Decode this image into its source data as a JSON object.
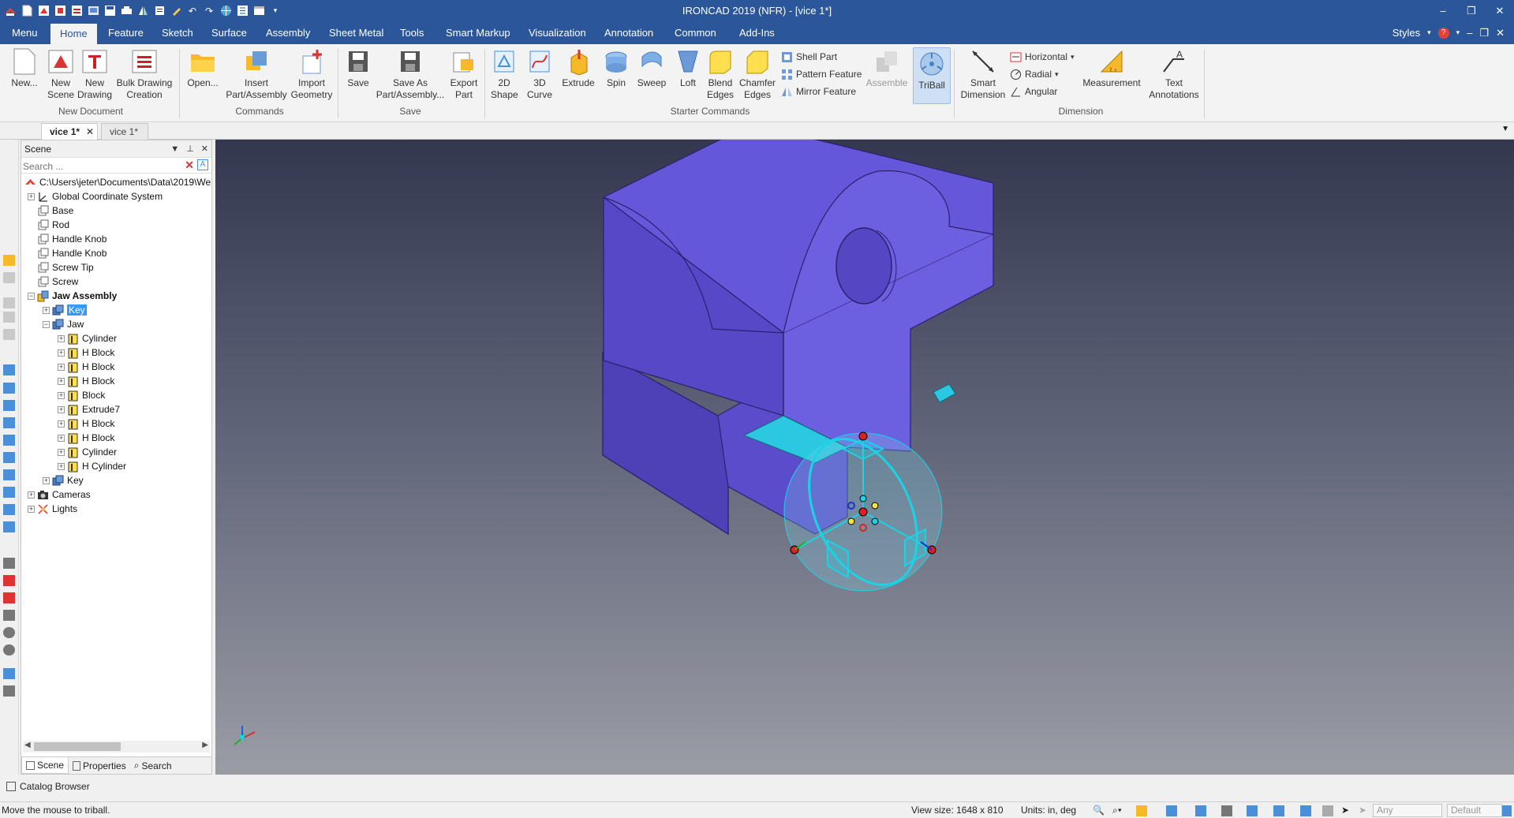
{
  "app": {
    "title": "IRONCAD 2019 (NFR) - [vice 1*]"
  },
  "qat": {
    "icons": [
      "new-file-icon",
      "new-scene-icon",
      "new-drawing-icon",
      "save-icon",
      "print-icon",
      "undo-icon",
      "redo-icon",
      "web-icon",
      "settings-icon",
      "dropdown-icon"
    ]
  },
  "menubar": {
    "tabs": [
      "Menu",
      "Home",
      "Feature",
      "Sketch",
      "Surface",
      "Assembly",
      "Sheet Metal",
      "Tools",
      "Smart Markup",
      "Visualization",
      "Annotation",
      "Common",
      "Add-Ins"
    ],
    "active": "Home",
    "styles_label": "Styles",
    "accent": "#2b579a"
  },
  "ribbon": {
    "new_label": "New...",
    "new_scene_label": "New Scene",
    "new_drawing_label": "New Drawing",
    "bulk_drawing_label": "Bulk Drawing Creation",
    "group_new_document": "New Document",
    "open_label": "Open...",
    "insert_label": "Insert Part/Assembly",
    "import_label": "Import Geometry",
    "group_commands": "Commands",
    "save_label": "Save",
    "save_as_label": "Save As Part/Assembly...",
    "export_label": "Export Part",
    "group_save": "Save",
    "shape2d_label": "2D Shape",
    "curve3d_label": "3D Curve",
    "extrude_label": "Extrude",
    "spin_label": "Spin",
    "sweep_label": "Sweep",
    "loft_label": "Loft",
    "blend_label": "Blend Edges",
    "chamfer_label": "Chamfer Edges",
    "shell_label": "Shell Part",
    "pattern_label": "Pattern Feature",
    "mirror_label": "Mirror Feature",
    "assemble_label": "Assemble",
    "triball_label": "TriBall",
    "group_starter": "Starter Commands",
    "smart_dim_label": "Smart Dimension",
    "horizontal_label": "Horizontal",
    "radial_label": "Radial",
    "angular_label": "Angular",
    "measurement_label": "Measurement",
    "text_annot_label": "Text Annotations",
    "group_dimension": "Dimension"
  },
  "doctabs": {
    "tabs": [
      "vice 1*",
      "vice 1*"
    ]
  },
  "scene_panel": {
    "title": "Scene",
    "search_placeholder": "Search ...",
    "root_path": "C:\\Users\\jeter\\Documents\\Data\\2019\\We",
    "nodes": [
      "Global Coordinate System",
      "Base",
      "Rod",
      "Handle Knob",
      "Handle Knob",
      "Screw Tip",
      "Screw",
      "Jaw Assembly",
      "Key",
      "Jaw",
      "Cylinder",
      "H Block",
      "H Block",
      "H Block",
      "Block",
      "Extrude7",
      "H Block",
      "H Block",
      "Cylinder",
      "H Cylinder",
      "Key",
      "Cameras",
      "Lights"
    ],
    "tabs": [
      "Scene",
      "Properties",
      "Search"
    ]
  },
  "catalog": {
    "label": "Catalog Browser"
  },
  "status": {
    "message": "Move the mouse to triball.",
    "view_size": "View size: 1648 x 810",
    "units": "Units: in, deg",
    "dropdown1": "Any",
    "dropdown2": "Default"
  },
  "colors": {
    "part": "#6457d9",
    "highlight": "#1ad3e6",
    "viewport_top": "#33374f",
    "viewport_bottom": "#9a9da5"
  }
}
